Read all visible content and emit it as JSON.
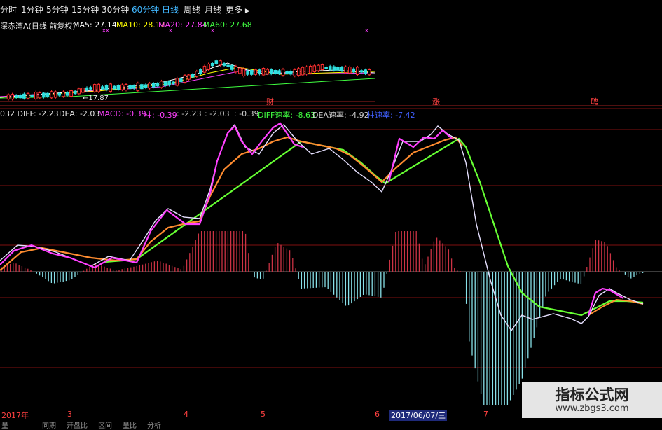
{
  "toolbar": {
    "tabs": [
      {
        "label": "分时",
        "active": false
      },
      {
        "label": "1分钟",
        "active": false
      },
      {
        "label": "5分钟",
        "active": false
      },
      {
        "label": "15分钟",
        "active": false
      },
      {
        "label": "30分钟",
        "active": false
      },
      {
        "label": "60分钟",
        "active": false
      },
      {
        "label": "日线",
        "active": true
      },
      {
        "label": "周线",
        "active": false
      },
      {
        "label": "月线",
        "active": false
      }
    ],
    "more_label": "更多",
    "more_icon": "chevron-right-icon"
  },
  "kline": {
    "title": "深赤湾A(日线 前复权)",
    "ma": [
      {
        "label": "MA5: 27.14",
        "color": "#ffffff"
      },
      {
        "label": "MA10: 28.17",
        "color": "#ffff00"
      },
      {
        "label": "MA20: 27.84",
        "color": "#ff40ff"
      },
      {
        "label": "MA60: 27.68",
        "color": "#40ff40"
      }
    ],
    "low_label": "←17.87",
    "events": [
      {
        "label": "财"
      },
      {
        "label": "涨"
      },
      {
        "label": "聘"
      }
    ]
  },
  "macd": {
    "header": [
      {
        "label": "032 DIFF: -2.23",
        "color": "#e6e6e6"
      },
      {
        "label": "DEA: -2.03",
        "color": "#e6e6e6"
      },
      {
        "label": "MACD: -0.39",
        "color": "#ff40ff"
      },
      {
        "label": "柱: -0.39",
        "color": "#ff40ff"
      },
      {
        "label": ": -2.23",
        "color": "#cccccc"
      },
      {
        "label": ": -2.03",
        "color": "#cccccc"
      },
      {
        "label": ": -0.39",
        "color": "#cccccc"
      },
      {
        "label": "DIFF速率: -8.63",
        "color": "#40ff40"
      },
      {
        "label": "DEA速率: -4.92",
        "color": "#cccccc"
      },
      {
        "label": "柱速率: -7.42",
        "color": "#4060ff"
      }
    ],
    "colors": {
      "diff": "#e6e0ff",
      "pink": "#ff40ff",
      "orange": "#ff8c30",
      "green": "#66ff33",
      "red_bar": "#cc3344",
      "cyan_bar": "#88e0e8",
      "grid": "#801010"
    }
  },
  "footer": {
    "dates": [
      {
        "label": "2017年",
        "highlight": false
      },
      {
        "label": "3",
        "highlight": false
      },
      {
        "label": "4",
        "highlight": false
      },
      {
        "label": "5",
        "highlight": false
      },
      {
        "label": "6",
        "highlight": false
      },
      {
        "label": "2017/06/07/三",
        "highlight": true
      },
      {
        "label": "7",
        "highlight": false
      }
    ],
    "stats": [
      "量",
      "同期",
      "开盘比",
      "区间",
      "量比",
      "分析"
    ]
  },
  "watermark": {
    "line1": "指标公式网",
    "line2": "www.zbgs3.com"
  }
}
